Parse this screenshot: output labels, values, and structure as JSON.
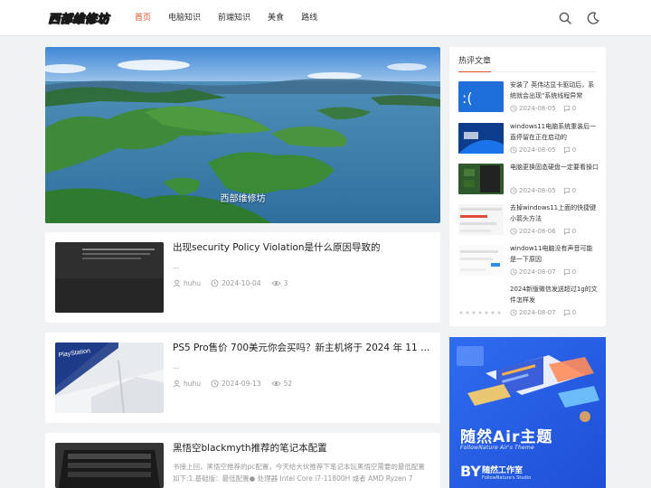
{
  "header": {
    "logo": "西部维修坊",
    "nav": [
      "首页",
      "电脑知识",
      "前端知识",
      "美食",
      "路线"
    ],
    "active_nav": "首页",
    "icons": [
      "search-icon",
      "moon-icon"
    ],
    "accent_color": "#e04e2b"
  },
  "hero": {
    "caption": "西部维修坊"
  },
  "posts": [
    {
      "title": "出现security Policy Violation是什么原因导致的",
      "excerpt": "...",
      "author": "huhu",
      "date": "2024-10-04",
      "views": "3"
    },
    {
      "title": "PS5 Pro售价 700美元你会买吗？新主机将于 2024 年 11 月 7 ...",
      "excerpt": "...",
      "author": "huhu",
      "date": "2024-09-13",
      "views": "52"
    },
    {
      "title": "黑悟空blackmyth推荐的笔记本配置",
      "excerpt": "书接上回，黑悟空推荐的pc配置，今天给大伙推荐下笔记本玩黑悟空需要的最低配置如下:1.基础版：最低配置● 处理器 Intel Core i7-11800H 或者 AMD Ryzen 7 5800H..."
    }
  ],
  "sidebar": {
    "hot_title": "热评文章",
    "hot_items": [
      {
        "title": "安装了 英伟达显卡驱动后，系统就会出现\"系统线程异常",
        "date": "2024-08-05",
        "comments": "0"
      },
      {
        "title": "windows11电脑系统重装后一直停留在正在启动的",
        "date": "2024-08-05",
        "comments": "0"
      },
      {
        "title": "电脑更换固态硬盘一定要看操口",
        "date": "2024-08-05",
        "comments": "0"
      },
      {
        "title": "去掉windows11上面的快捷键小箭头方法",
        "date": "2024-08-06",
        "comments": "0"
      },
      {
        "title": "window11电脑没有声音可能是一下原因",
        "date": "2024-08-07",
        "comments": "0"
      },
      {
        "title": "2024新版微信发送超过1g的文件怎样发",
        "date": "2024-08-07",
        "comments": "0"
      }
    ]
  },
  "ad": {
    "title": "随然Air主题",
    "subtitle": "FollowNature Air's Theme",
    "brand_mark": "BY",
    "brand_name": "随然工作室",
    "brand_sub": "FollowNature's Studio"
  }
}
